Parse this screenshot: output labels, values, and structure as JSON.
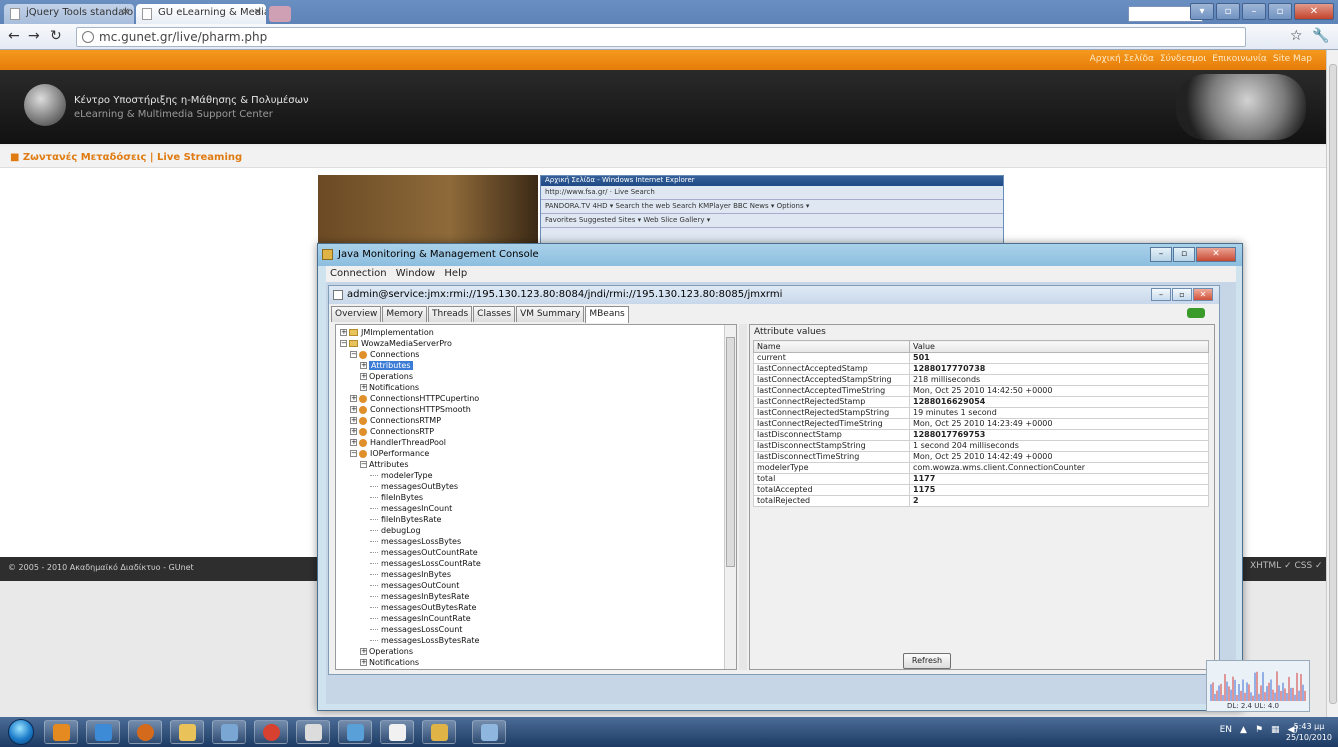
{
  "browser": {
    "tabs": [
      {
        "label": "jQuery Tools standalone ...",
        "active": false
      },
      {
        "label": "GU eLearning & Media C...",
        "active": true
      }
    ],
    "url": "mc.gunet.gr/live/pharm.php"
  },
  "site": {
    "top_links": [
      "Αρχική Σελίδα",
      "Σύνδεσμοι",
      "Επικοινωνία",
      "Site Map"
    ],
    "title_gr": "Κέντρο Υποστήριξης η-Μάθησης & Πολυμέσων",
    "title_en": "eLearning & Multimedia Support Center",
    "breadcrumb": "■ Ζωντανές Μεταδόσεις | Live Streaming",
    "footer": "© 2005 - 2010 Ακαδημαϊκό Διαδίκτυο - GUnet",
    "footer_right": "XHTML ✓  CSS ✓"
  },
  "ie_window": {
    "title": "Αρχική Σελίδα - Windows Internet Explorer",
    "address": "http://www.fsa.gr/",
    "search": "Live Search",
    "toolbar": "PANDORA.TV 4HD ▾  Search the web   Search   KMPlayer   BBC News ▾   Options ▾",
    "favorites": "Favorites   Suggested Sites ▾   Web Slice Gallery ▾"
  },
  "jconsole": {
    "title": "Java Monitoring & Management Console",
    "menu": [
      "Connection",
      "Window",
      "Help"
    ],
    "connection_title": "admin@service:jmx:rmi://195.130.123.80:8084/jndi/rmi://195.130.123.80:8085/jmxrmi",
    "tabs": [
      "Overview",
      "Memory",
      "Threads",
      "Classes",
      "VM Summary",
      "MBeans"
    ],
    "active_tab": "MBeans",
    "tree": [
      {
        "label": "JMImplementation",
        "level": 0,
        "kind": "folder"
      },
      {
        "label": "WowzaMediaServerPro",
        "level": 0,
        "kind": "folder"
      },
      {
        "label": "Connections",
        "level": 1,
        "kind": "bean"
      },
      {
        "label": "Attributes",
        "level": 2,
        "kind": "exp",
        "selected": true
      },
      {
        "label": "Operations",
        "level": 2,
        "kind": "exp"
      },
      {
        "label": "Notifications",
        "level": 2,
        "kind": "exp"
      },
      {
        "label": "ConnectionsHTTPCupertino",
        "level": 1,
        "kind": "bean"
      },
      {
        "label": "ConnectionsHTTPSmooth",
        "level": 1,
        "kind": "bean"
      },
      {
        "label": "ConnectionsRTMP",
        "level": 1,
        "kind": "bean"
      },
      {
        "label": "ConnectionsRTP",
        "level": 1,
        "kind": "bean"
      },
      {
        "label": "HandlerThreadPool",
        "level": 1,
        "kind": "bean"
      },
      {
        "label": "IOPerformance",
        "level": 1,
        "kind": "bean"
      },
      {
        "label": "Attributes",
        "level": 2,
        "kind": "exp"
      },
      {
        "label": "modelerType",
        "level": 3,
        "kind": "leaf"
      },
      {
        "label": "messagesOutBytes",
        "level": 3,
        "kind": "leaf"
      },
      {
        "label": "fileInBytes",
        "level": 3,
        "kind": "leaf"
      },
      {
        "label": "messagesInCount",
        "level": 3,
        "kind": "leaf"
      },
      {
        "label": "fileInBytesRate",
        "level": 3,
        "kind": "leaf"
      },
      {
        "label": "debugLog",
        "level": 3,
        "kind": "leaf"
      },
      {
        "label": "messagesLossBytes",
        "level": 3,
        "kind": "leaf"
      },
      {
        "label": "messagesOutCountRate",
        "level": 3,
        "kind": "leaf"
      },
      {
        "label": "messagesLossCountRate",
        "level": 3,
        "kind": "leaf"
      },
      {
        "label": "messagesInBytes",
        "level": 3,
        "kind": "leaf"
      },
      {
        "label": "messagesOutCount",
        "level": 3,
        "kind": "leaf"
      },
      {
        "label": "messagesInBytesRate",
        "level": 3,
        "kind": "leaf"
      },
      {
        "label": "messagesOutBytesRate",
        "level": 3,
        "kind": "leaf"
      },
      {
        "label": "messagesInCountRate",
        "level": 3,
        "kind": "leaf"
      },
      {
        "label": "messagesLossCount",
        "level": 3,
        "kind": "leaf"
      },
      {
        "label": "messagesLossBytesRate",
        "level": 3,
        "kind": "leaf"
      },
      {
        "label": "Operations",
        "level": 2,
        "kind": "exp"
      },
      {
        "label": "Notifications",
        "level": 2,
        "kind": "exp"
      }
    ],
    "attr_panel": {
      "label": "Attribute values",
      "headers": [
        "Name",
        "Value"
      ],
      "rows": [
        {
          "name": "current",
          "value": "501",
          "bold": true
        },
        {
          "name": "lastConnectAcceptedStamp",
          "value": "1288017770738",
          "bold": true
        },
        {
          "name": "lastConnectAcceptedStampString",
          "value": "218 milliseconds",
          "bold": false
        },
        {
          "name": "lastConnectAcceptedTimeString",
          "value": "Mon, Oct 25 2010 14:42:50 +0000",
          "bold": false
        },
        {
          "name": "lastConnectRejectedStamp",
          "value": "1288016629054",
          "bold": true
        },
        {
          "name": "lastConnectRejectedStampString",
          "value": "19 minutes 1 second",
          "bold": false
        },
        {
          "name": "lastConnectRejectedTimeString",
          "value": "Mon, Oct 25 2010 14:23:49 +0000",
          "bold": false
        },
        {
          "name": "lastDisconnectStamp",
          "value": "1288017769753",
          "bold": true
        },
        {
          "name": "lastDisconnectStampString",
          "value": "1 second 204 milliseconds",
          "bold": false
        },
        {
          "name": "lastDisconnectTimeString",
          "value": "Mon, Oct 25 2010 14:42:49 +0000",
          "bold": false
        },
        {
          "name": "modelerType",
          "value": "com.wowza.wms.client.ConnectionCounter",
          "bold": false
        },
        {
          "name": "total",
          "value": "1177",
          "bold": true
        },
        {
          "name": "totalAccepted",
          "value": "1175",
          "bold": true
        },
        {
          "name": "totalRejected",
          "value": "2",
          "bold": true
        }
      ],
      "refresh_label": "Refresh"
    }
  },
  "netmeter": {
    "text": "DL: 2.4 UL: 4.0"
  },
  "taskbar": {
    "tray_lang": "EN",
    "time": "5:43 μμ",
    "date": "25/10/2010",
    "colors": {
      "start": "#1b7bc9"
    }
  }
}
